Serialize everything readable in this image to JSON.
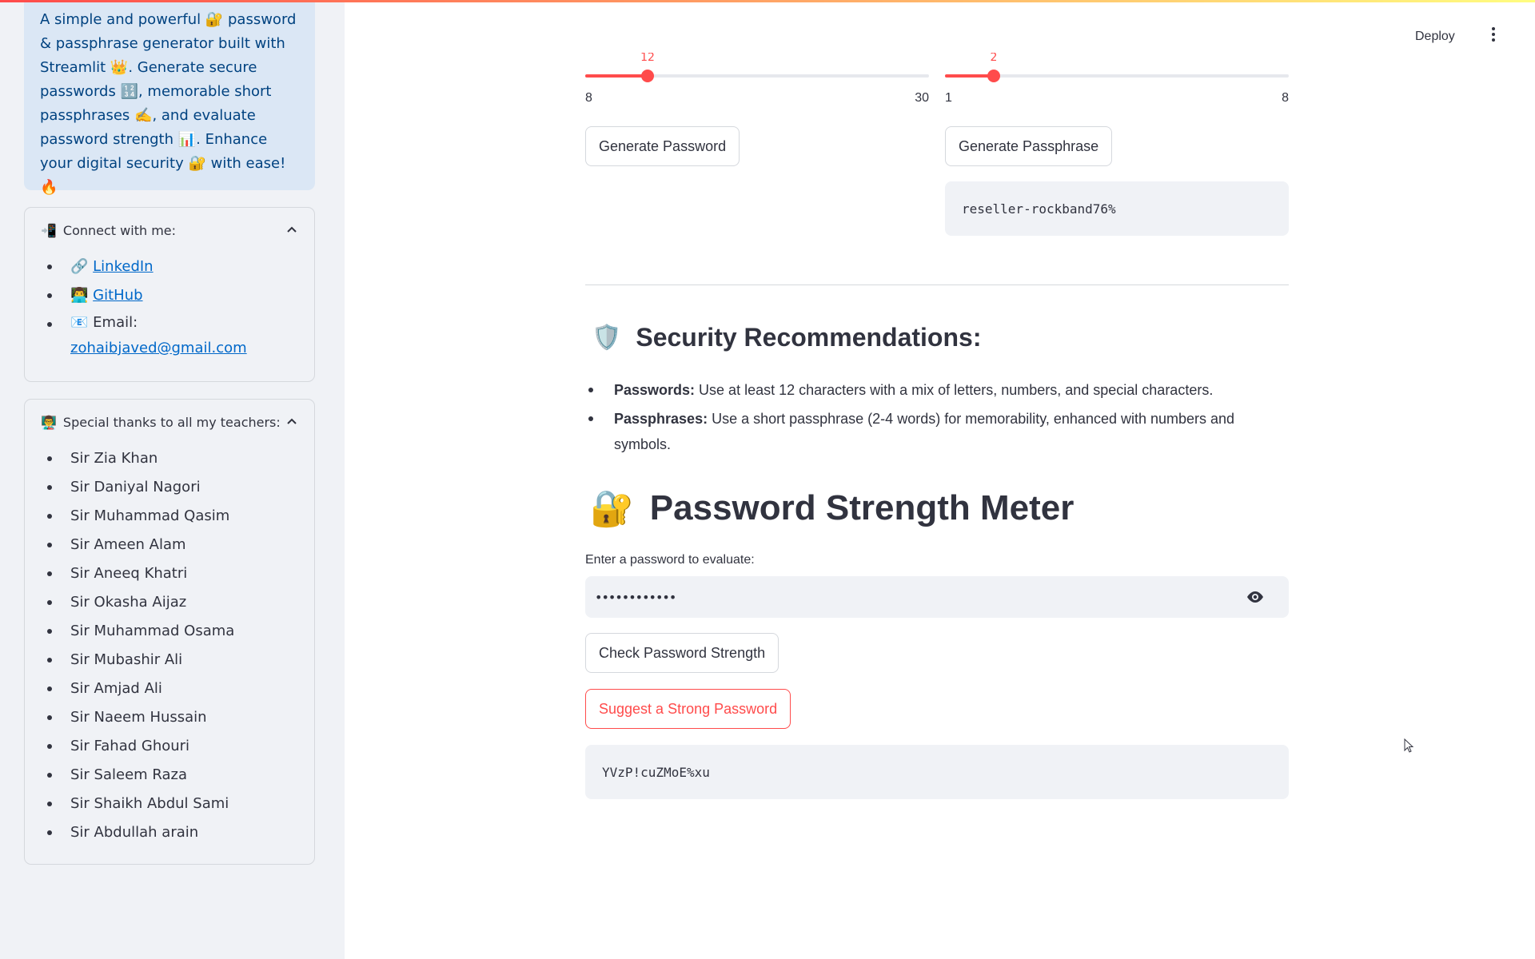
{
  "sidebar": {
    "intro": {
      "parts": [
        "A simple and powerful ",
        "🔐",
        " password & passphrase generator built with Streamlit ",
        "👑",
        ". Generate secure passwords ",
        "🔢",
        ", memorable short passphrases ",
        "✍️",
        ", and evaluate password strength ",
        "📊",
        ". Enhance your digital security ",
        "🔐",
        " with ease! ",
        "🔥"
      ]
    },
    "connect": {
      "emoji": "📲",
      "title": "Connect with me:",
      "items": [
        {
          "emoji": "🔗",
          "label": "LinkedIn"
        },
        {
          "emoji": "👨‍💻",
          "label": "GitHub"
        },
        {
          "emoji": "📧",
          "label": "Email:",
          "link": "zohaibjaved@gmail.com"
        }
      ]
    },
    "teachers": {
      "emoji": "👨‍🏫",
      "title": "Special thanks to all my teachers:",
      "items": [
        "Sir Zia Khan",
        "Sir Daniyal Nagori",
        "Sir Muhammad Qasim",
        "Sir Ameen Alam",
        "Sir Aneeq Khatri",
        "Sir Okasha Aijaz",
        "Sir Muhammad Osama",
        "Sir Mubashir Ali",
        "Sir Amjad Ali",
        "Sir Naeem Hussain",
        "Sir Fahad Ghouri",
        "Sir Saleem Raza",
        "Sir Shaikh Abdul Sami",
        "Sir Abdullah arain"
      ]
    }
  },
  "header": {
    "deploy_label": "Deploy",
    "menu_icon": "kebab-menu-icon"
  },
  "password_slider": {
    "value": "12",
    "min": "8",
    "max": "30"
  },
  "passphrase_slider": {
    "value": "2",
    "min": "1",
    "max": "8"
  },
  "buttons": {
    "generate_password": "Generate Password",
    "generate_passphrase": "Generate Passphrase",
    "check_strength": "Check Password Strength",
    "suggest_strong": "Suggest a Strong Password"
  },
  "generated_passphrase": "reseller-rockband76%",
  "recommendations": {
    "emoji": "🛡️",
    "title": "Security Recommendations:",
    "items": [
      {
        "bold": "Passwords:",
        "text": " Use at least 12 characters with a mix of letters, numbers, and special characters."
      },
      {
        "bold": "Passphrases:",
        "text": " Use a short passphrase (2-4 words) for memorability, enhanced with numbers and symbols."
      }
    ]
  },
  "strength_meter": {
    "emoji": "🔐",
    "title": "Password Strength Meter",
    "input_label": "Enter a password to evaluate:",
    "input_value": "••••••••••••",
    "eye_icon": "eye-icon"
  },
  "suggested_password": "YVzP!cuZMoE%xu",
  "colors": {
    "accent": "#ff4b4b",
    "info_bg": "#dbe7f5",
    "info_text": "#004280",
    "sidebar_bg": "#f0f2f6",
    "link": "#0068c9"
  }
}
